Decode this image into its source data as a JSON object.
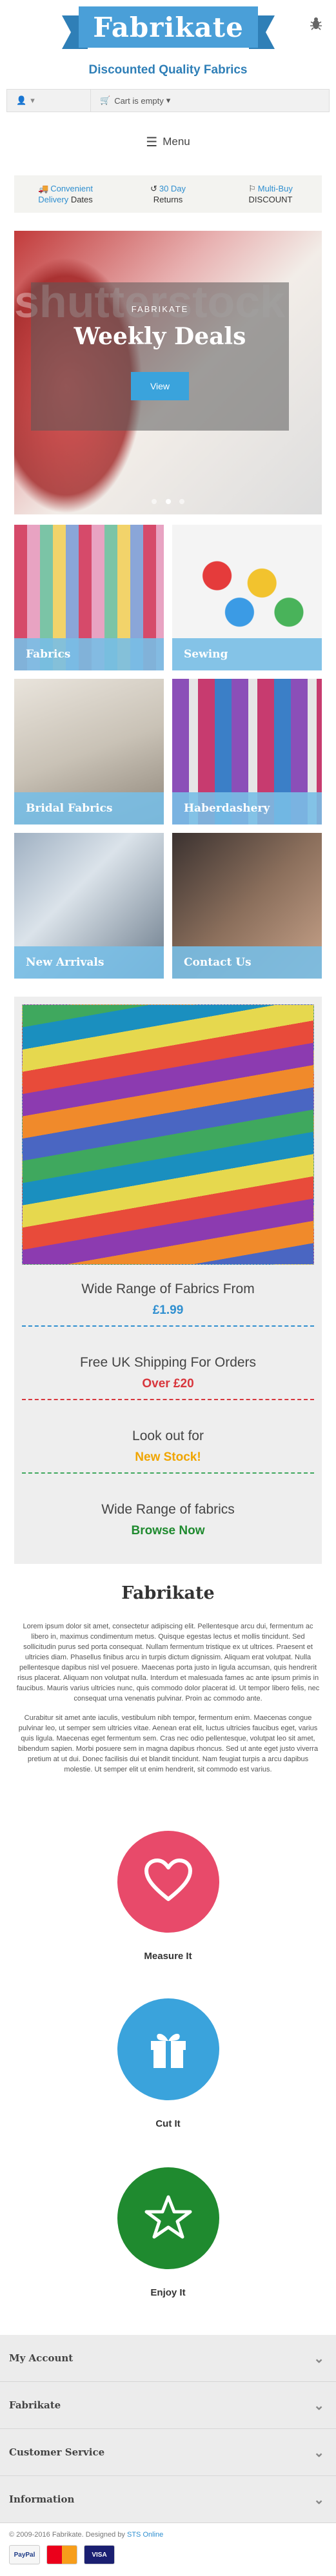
{
  "header": {
    "logo": "Fabrikate",
    "tagline": "Discounted Quality Fabrics",
    "icon": "bug-icon"
  },
  "topbar": {
    "user_icon": "user-icon",
    "cart_text": "Cart is empty",
    "cart_icon": "shopping-cart-icon"
  },
  "menu": {
    "label": "Menu",
    "icon": "hamburger-icon"
  },
  "usp": [
    {
      "icon": "truck-icon",
      "line1": "Convenient",
      "line2_hl": "Delivery",
      "line2": "Dates"
    },
    {
      "icon": "return-icon",
      "line1": "30 Day",
      "line2": "Returns"
    },
    {
      "icon": "tag-icon",
      "line1": "Multi-Buy",
      "line2": "DISCOUNT"
    }
  ],
  "hero": {
    "kicker": "FABRIKATE",
    "title": "Weekly Deals",
    "button": "View",
    "watermark": "shutterstock",
    "slides": 3,
    "active_slide": 1
  },
  "categories": [
    {
      "label": "Fabrics",
      "image": "fabrics"
    },
    {
      "label": "Sewing",
      "image": "sewing"
    },
    {
      "label": "Bridal Fabrics",
      "image": "bridal"
    },
    {
      "label": "Haberdashery",
      "image": "haber"
    },
    {
      "label": "New Arrivals",
      "image": "new"
    },
    {
      "label": "Contact Us",
      "image": "contact"
    }
  ],
  "promo": [
    {
      "title": "Wide Range of Fabrics From",
      "sub": "£1.99"
    },
    {
      "title": "Free UK Shipping For Orders",
      "sub": "Over £20"
    },
    {
      "title": "Look out for",
      "sub": "New Stock!"
    },
    {
      "title": "Wide Range of fabrics",
      "sub": "Browse Now"
    }
  ],
  "about": {
    "title": "Fabrikate",
    "p1": "Lorem ipsum dolor sit amet, consectetur adipiscing elit. Pellentesque arcu dui, fermentum ac libero in, maximus condimentum metus. Quisque egestas lectus et mollis tincidunt. Sed sollicitudin purus sed porta consequat. Nullam fermentum tristique ex ut ultrices. Praesent et ultricies diam. Phasellus finibus arcu in turpis dictum dignissim. Aliquam erat volutpat. Nulla pellentesque dapibus nisl vel posuere. Maecenas porta justo in ligula accumsan, quis hendrerit risus placerat. Aliquam non volutpat nulla. Interdum et malesuada fames ac ante ipsum primis in faucibus. Mauris varius ultricies nunc, quis commodo dolor placerat id. Ut tempor libero felis, nec consequat urna venenatis pulvinar. Proin ac commodo ante.",
    "p2": "Curabitur sit amet ante iaculis, vestibulum nibh tempor, fermentum enim. Maecenas congue pulvinar leo, ut semper sem ultricies vitae. Aenean erat elit, luctus ultricies faucibus eget, varius quis ligula. Maecenas eget fermentum sem. Cras nec odio pellentesque, volutpat leo sit amet, bibendum sapien. Morbi posuere sem in magna dapibus rhoncus. Sed ut ante eget justo viverra pretium at ut dui. Donec facilisis dui et blandit tincidunt. Nam feugiat turpis a arcu dapibus molestie. Ut semper elit ut enim hendrerit, sit commodo est varius."
  },
  "features": [
    {
      "label": "Measure It",
      "icon": "heart-icon",
      "color": "#e84a6a"
    },
    {
      "label": "Cut It",
      "icon": "gift-icon",
      "color": "#3aa3dc"
    },
    {
      "label": "Enjoy It",
      "icon": "star-icon",
      "color": "#1f8a2f"
    }
  ],
  "footer": {
    "sections": [
      "My Account",
      "Fabrikate",
      "Customer Service",
      "Information"
    ],
    "copyright": "© 2009-2016 Fabrikate. Designed by",
    "designer": "STS Online",
    "payments": [
      "PayPal",
      "MasterCard",
      "VISA"
    ]
  },
  "colors": {
    "brand_blue": "#4a9fd8",
    "accent_red": "#d8363d",
    "accent_green": "#1f8a2f",
    "accent_orange": "#f0a500"
  }
}
